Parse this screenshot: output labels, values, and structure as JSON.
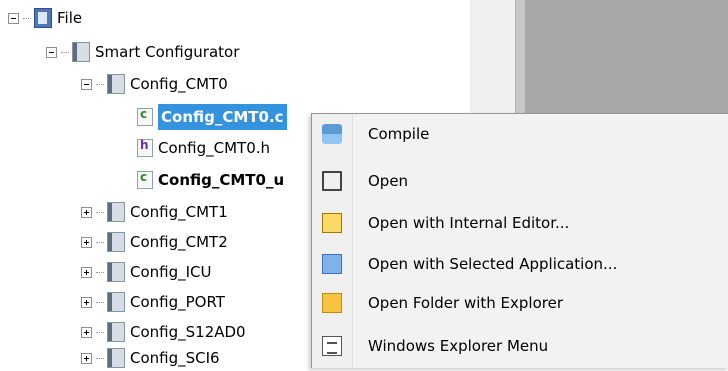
{
  "tree": {
    "file": "File",
    "smart_configurator": "Smart Configurator",
    "config_cmt0": "Config_CMT0",
    "config_cmt0_c": "Config_CMT0.c",
    "config_cmt0_h": "Config_CMT0.h",
    "config_cmt0_user": "Config_CMT0_u",
    "config_cmt1": "Config_CMT1",
    "config_cmt2": "Config_CMT2",
    "config_icu": "Config_ICU",
    "config_port": "Config_PORT",
    "config_s12ad0": "Config_S12AD0",
    "config_sci6": "Config_SCI6"
  },
  "menu": [
    "Compile",
    "Open",
    "Open with Internal Editor...",
    "Open with Selected Application...",
    "Open Folder with Explorer",
    "Windows Explorer Menu"
  ]
}
